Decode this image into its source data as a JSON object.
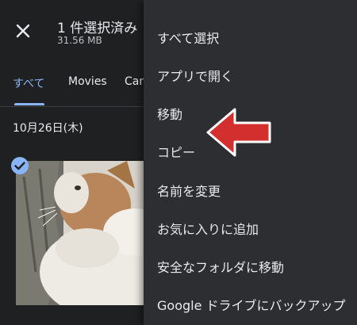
{
  "header": {
    "title": "1 件選択済み",
    "subtitle": "31.56 MB",
    "close_icon": "close-icon"
  },
  "tabs": [
    {
      "label": "すべて",
      "active": true
    },
    {
      "label": "Movies",
      "active": false
    },
    {
      "label": "Cam",
      "active": false
    }
  ],
  "date_label": "10月26日(木)",
  "photo": {
    "selected": true,
    "check_icon": "check-circle-icon"
  },
  "menu": {
    "items": [
      {
        "label": "すべて選択"
      },
      {
        "label": "アプリで開く"
      },
      {
        "label": "移動"
      },
      {
        "label": "コピー"
      },
      {
        "label": "名前を変更"
      },
      {
        "label": "お気に入りに追加"
      },
      {
        "label": "安全なフォルダに移動"
      },
      {
        "label": "Google ドライブにバックアップ"
      }
    ]
  },
  "annotation": {
    "icon": "red-arrow-icon",
    "color": "#d32f2f"
  },
  "colors": {
    "accent": "#8ab4f8",
    "background": "#1f2021",
    "menu_bg": "#2d2e31"
  }
}
